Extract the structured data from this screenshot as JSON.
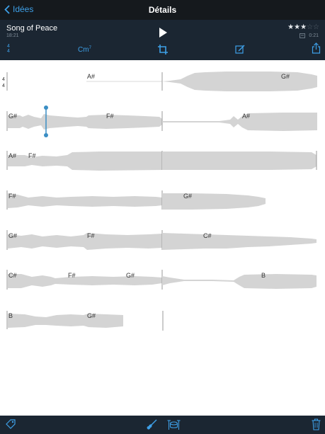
{
  "nav": {
    "back_label": "Idées",
    "title": "Détails"
  },
  "song": {
    "title": "Song of Peace",
    "time": "18:21",
    "duration": "0:21",
    "rating": 3,
    "rating_max": 5
  },
  "toolbar": {
    "time_sig_top": "4",
    "time_sig_bottom": "4",
    "key_root": "Cm",
    "key_ext": "7"
  },
  "score": {
    "time_signature": [
      "4",
      "4"
    ],
    "rows": [
      {
        "chords": [
          "A#",
          "G#"
        ]
      },
      {
        "chords": [
          "G#",
          "F#",
          "A#"
        ]
      },
      {
        "chords": [
          "A#",
          "F#"
        ]
      },
      {
        "chords": [
          "F#",
          "G#"
        ]
      },
      {
        "chords": [
          "G#",
          "F#",
          "C#"
        ]
      },
      {
        "chords": [
          "C#",
          "F#",
          "G#",
          "B"
        ]
      },
      {
        "chords": [
          "B",
          "G#"
        ]
      }
    ]
  },
  "icons": {
    "back": "chevron-left-icon",
    "play": "play-icon",
    "crop": "crop-icon",
    "edit": "edit-icon",
    "share": "share-icon",
    "tag": "tag-icon",
    "guitar": "guitar-icon",
    "drums": "drums-icon",
    "trash": "trash-icon",
    "device": "device-icon"
  },
  "colors": {
    "accent": "#3ea0e8",
    "nav_bg": "#15191d",
    "header_bg": "#1b2632",
    "waveform": "#d4d4d4",
    "playhead": "#3a8ec4"
  }
}
